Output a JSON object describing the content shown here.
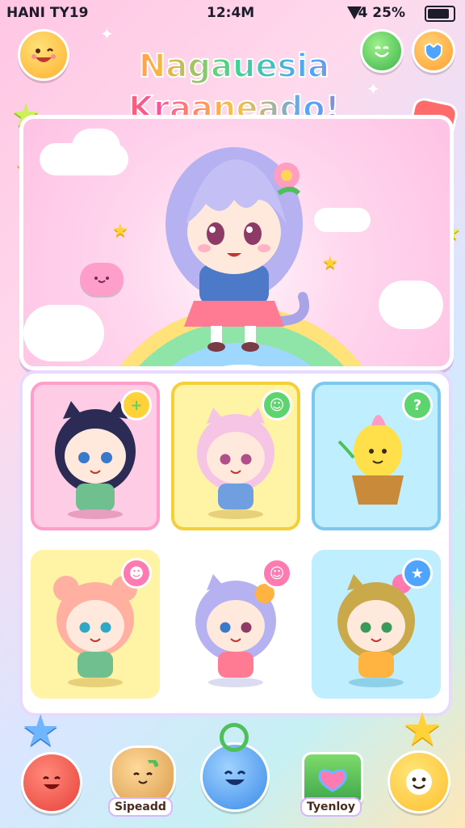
{
  "status_bar": {
    "carrier": "HANI TY19",
    "time": "12:4M",
    "battery": "4 25%"
  },
  "title": {
    "line1": "Nagauesia",
    "line2": "Kraaneado!"
  },
  "bottom_nav": {
    "label_left": "Sipeadd",
    "label_right": "Tyenloy"
  },
  "colors": {
    "pink": "#ffb3d9",
    "yellow": "#fff3a6",
    "blue": "#bfeeff",
    "badge_green": "#5ed46f",
    "badge_orange": "#ffab3d",
    "badge_blue": "#4fa4ff"
  },
  "icons": {
    "top_left": "smiling-face-icon",
    "top_right_1": "green-smile-icon",
    "top_right_2": "blue-heart-icon",
    "nav_1": "red-face-icon",
    "nav_2": "cat-face-icon",
    "nav_3": "blue-smile-icon",
    "nav_4": "heart-icon",
    "nav_5": "white-face-icon"
  }
}
